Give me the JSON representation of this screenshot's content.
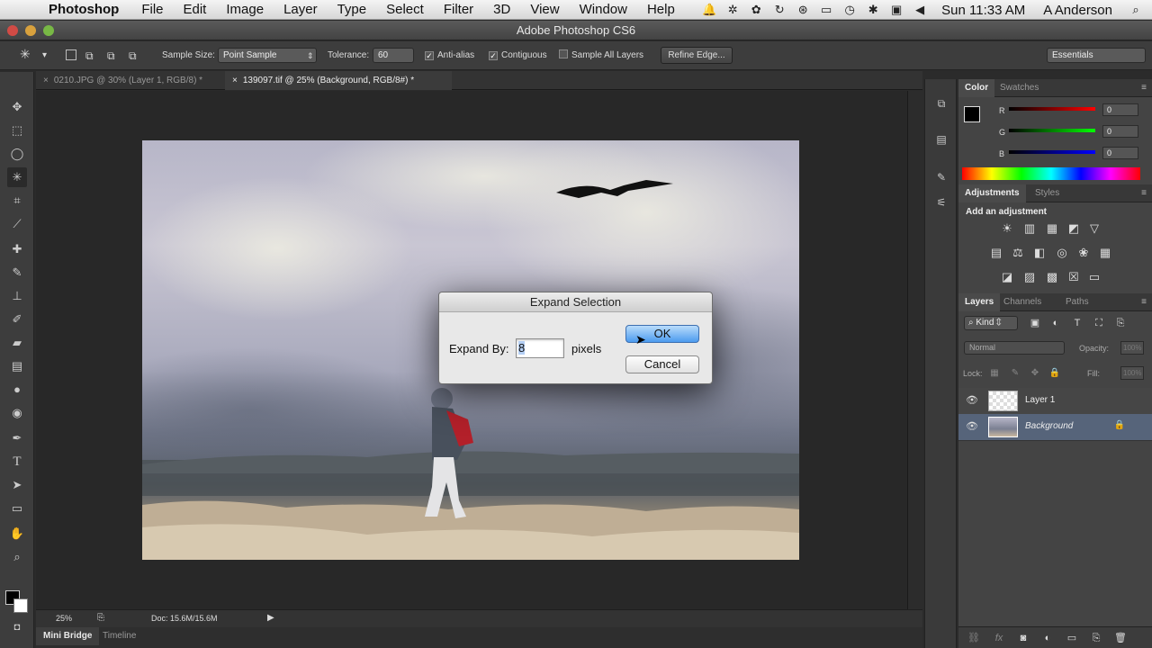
{
  "menubar": {
    "app": "Photoshop",
    "items": [
      "File",
      "Edit",
      "Image",
      "Layer",
      "Type",
      "Select",
      "Filter",
      "3D",
      "View",
      "Window",
      "Help"
    ],
    "clock": "Sun 11:33 AM",
    "user": "A Anderson"
  },
  "window": {
    "title": "Adobe Photoshop CS6"
  },
  "options": {
    "sample_size_label": "Sample Size:",
    "sample_size_value": "Point Sample",
    "tolerance_label": "Tolerance:",
    "tolerance_value": "60",
    "anti_alias": "Anti-alias",
    "contiguous": "Contiguous",
    "sample_all_layers": "Sample All Layers",
    "refine_edge": "Refine Edge...",
    "workspace": "Essentials"
  },
  "tabs": [
    {
      "label": "0210.JPG @ 30% (Layer 1, RGB/8) *"
    },
    {
      "label": "139097.tif @ 25% (Background, RGB/8#) *"
    }
  ],
  "dialog": {
    "title": "Expand Selection",
    "field_label": "Expand By:",
    "field_value": "8",
    "unit": "pixels",
    "ok": "OK",
    "cancel": "Cancel"
  },
  "status": {
    "zoom": "25%",
    "doc": "Doc: 15.6M/15.6M"
  },
  "bottom_tabs": {
    "mini_bridge": "Mini Bridge",
    "timeline": "Timeline"
  },
  "color_panel": {
    "tabs": [
      "Color",
      "Swatches"
    ],
    "r_label": "R",
    "g_label": "G",
    "b_label": "B",
    "r": "0",
    "g": "0",
    "b": "0"
  },
  "adjustments_panel": {
    "tabs": [
      "Adjustments",
      "Styles"
    ],
    "heading": "Add an adjustment"
  },
  "layers_panel": {
    "tabs": [
      "Layers",
      "Channels",
      "Paths"
    ],
    "kind": "Kind",
    "blend": "Normal",
    "opacity_label": "Opacity:",
    "opacity": "100%",
    "lock_label": "Lock:",
    "fill_label": "Fill:",
    "fill": "100%",
    "layers": [
      "Layer 1",
      "Background"
    ]
  }
}
